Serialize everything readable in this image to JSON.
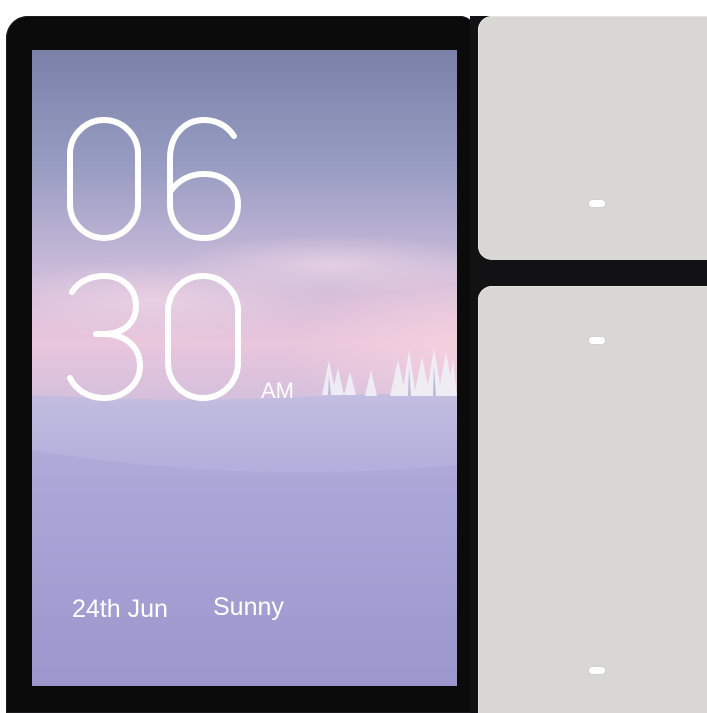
{
  "clock": {
    "hour": "06",
    "minute": "30",
    "period": "AM"
  },
  "info": {
    "date": "24th Jun",
    "weather": "Sunny"
  },
  "switch_panels": [
    {
      "name": "top-switch",
      "indicator": "indicator-light"
    },
    {
      "name": "bottom-switch",
      "indicators": [
        "indicator-light",
        "indicator-light"
      ]
    }
  ],
  "colors": {
    "bezel": "#0b0b0c",
    "switch_panel": "#d9d7d3",
    "indicator": "#ffffff",
    "text": "#ffffff"
  }
}
